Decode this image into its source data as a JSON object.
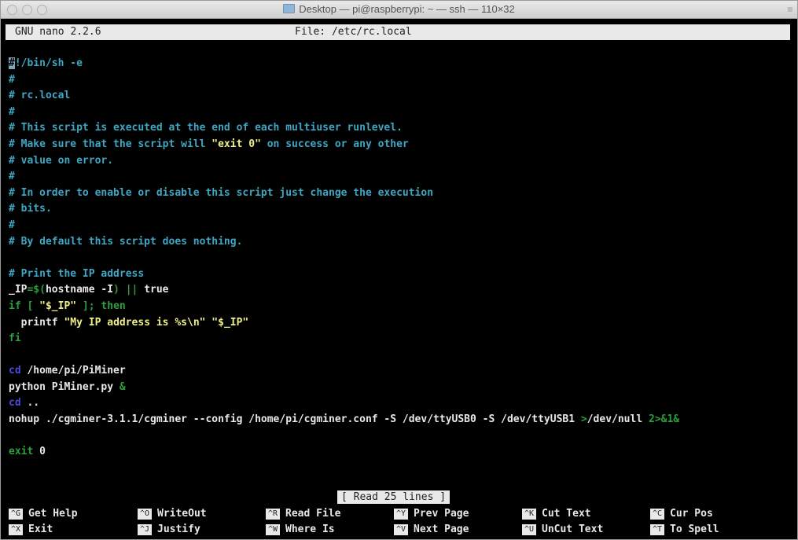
{
  "window": {
    "title": "Desktop — pi@raspberrypi: ~ — ssh — 110×32"
  },
  "nano": {
    "version": "GNU nano 2.2.6",
    "file": "File: /etc/rc.local"
  },
  "lines": {
    "l01": {
      "cursor": "#",
      "text": "!/bin/sh -e"
    },
    "l02": "#",
    "l03": "# rc.local",
    "l04": "#",
    "l05": "# This script is executed at the end of each multiuser runlevel.",
    "l06": {
      "a": "# Make sure that the script will ",
      "b": "\"exit 0\"",
      "c": " on success or any other"
    },
    "l07": "# value on error.",
    "l08": "#",
    "l09": "# In order to enable or disable this script just change the execution",
    "l10": "# bits.",
    "l11": "#",
    "l12": "# By default this script does nothing.",
    "l13": "",
    "l14": "# Print the IP address",
    "l15": {
      "a": "_IP",
      "b": "=$(",
      "c": "hostname -I",
      "d": ")",
      "e": " || ",
      "f": "true"
    },
    "l16": {
      "a": "if [ ",
      "b": "\"$_IP\"",
      "c": " ]; then"
    },
    "l17": {
      "a": "  printf ",
      "b": "\"My IP address is %s\\n\" \"$_IP\""
    },
    "l18": "fi",
    "l19": "",
    "l20": {
      "a": "cd",
      "b": " /home/pi/PiMiner"
    },
    "l21": {
      "a": "python PiMiner.py ",
      "b": "&"
    },
    "l22": {
      "a": "cd",
      "b": " .."
    },
    "l23": {
      "a": "nohup ./cgminer-3.1.1/cgminer --config /home/pi/cgminer.conf -S /dev/ttyUSB0 -S /dev/ttyUSB1 ",
      "b": ">",
      "c": "/dev/null ",
      "d": "2>&1&"
    },
    "l24": "",
    "l25": {
      "a": "exit",
      "b": " 0"
    }
  },
  "message": "[ Read 25 lines ]",
  "shortcuts": [
    {
      "key": "^G",
      "label": "Get Help"
    },
    {
      "key": "^O",
      "label": "WriteOut"
    },
    {
      "key": "^R",
      "label": "Read File"
    },
    {
      "key": "^Y",
      "label": "Prev Page"
    },
    {
      "key": "^K",
      "label": "Cut Text"
    },
    {
      "key": "^C",
      "label": "Cur Pos"
    },
    {
      "key": "^X",
      "label": "Exit"
    },
    {
      "key": "^J",
      "label": "Justify"
    },
    {
      "key": "^W",
      "label": "Where Is"
    },
    {
      "key": "^V",
      "label": "Next Page"
    },
    {
      "key": "^U",
      "label": "UnCut Text"
    },
    {
      "key": "^T",
      "label": "To Spell"
    }
  ],
  "colors": {
    "background": "#000000",
    "comment": "#3fa6c3",
    "string_highlight": "#f0f08a",
    "keyword": "#2ca03a",
    "cd_keyword": "#4a4ad8",
    "status_bar": "#e9e9e9"
  }
}
